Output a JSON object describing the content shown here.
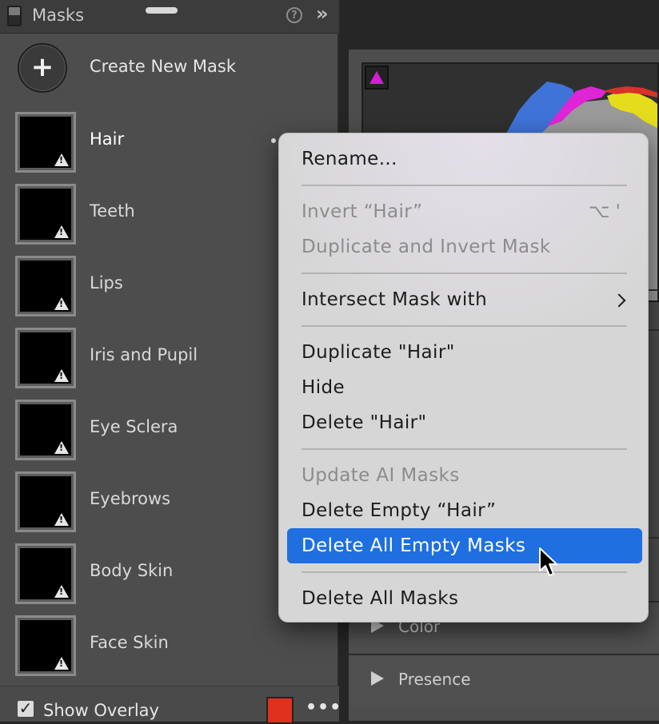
{
  "masks_panel": {
    "title": "Masks",
    "help_symbol": "?",
    "collapse_symbol": "»",
    "create_symbol": "+",
    "create_label": "Create New Mask",
    "items": [
      {
        "label": "Hair",
        "active": true
      },
      {
        "label": "Teeth"
      },
      {
        "label": "Lips"
      },
      {
        "label": "Iris and Pupil"
      },
      {
        "label": "Eye Sclera"
      },
      {
        "label": "Eyebrows"
      },
      {
        "label": "Body Skin"
      },
      {
        "label": "Face Skin"
      }
    ],
    "footer": {
      "checkbox_symbol": "✓",
      "overlay_label": "Show Overlay",
      "overlay_checked": true,
      "overlay_color": "#e0301e",
      "more_symbol": "•••"
    }
  },
  "right_panel": {
    "sections": [
      {
        "label": "Color",
        "icon": "triangle-right-icon"
      },
      {
        "label": "Presence",
        "icon": "triangle-right-icon"
      }
    ],
    "histogram_colors": {
      "blue": "#3f73d8",
      "magenta": "#e025d6",
      "yellow": "#e4dc1c",
      "red": "#d8322a",
      "gray": "#9a9a9a"
    }
  },
  "context_menu": {
    "rename": "Rename...",
    "invert": "Invert “Hair”",
    "invert_shortcut": "⌥ '",
    "duplicate_invert": "Duplicate and Invert Mask",
    "intersect": "Intersect Mask with",
    "duplicate": "Duplicate \"Hair\"",
    "hide": "Hide",
    "delete": "Delete \"Hair\"",
    "update_ai": "Update AI Masks",
    "delete_empty": "Delete Empty “Hair”",
    "delete_all_empty": "Delete All Empty Masks",
    "delete_all": "Delete All Masks",
    "highlight_color": "#1f6fe0"
  }
}
